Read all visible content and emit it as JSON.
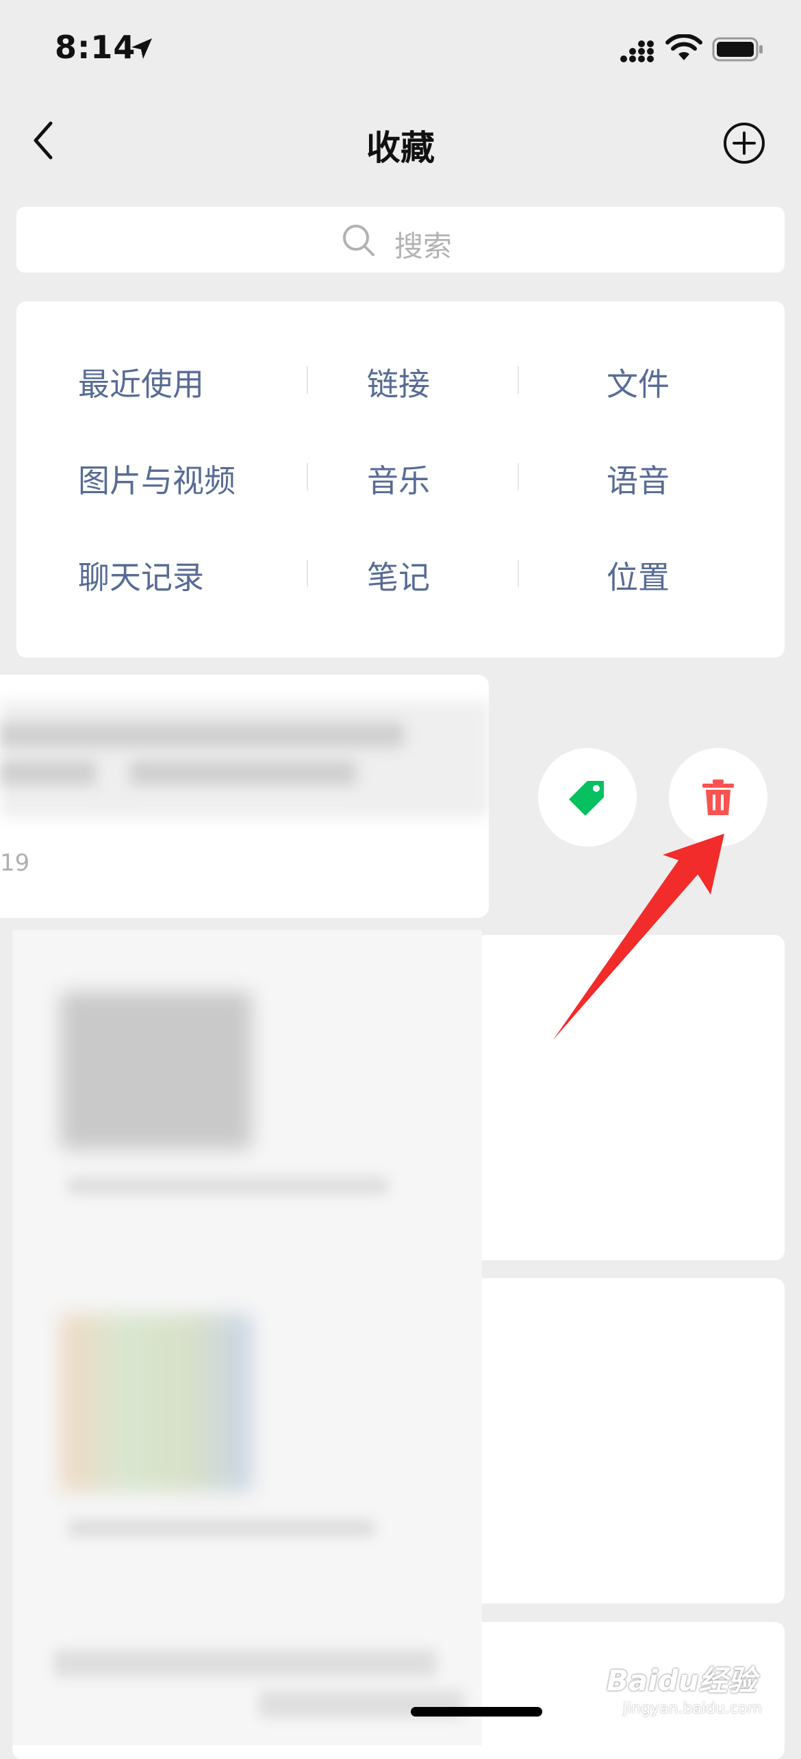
{
  "status_bar": {
    "time": "8:14"
  },
  "nav": {
    "title": "收藏"
  },
  "search": {
    "placeholder": "搜索"
  },
  "categories": [
    [
      "最近使用",
      "链接",
      "文件"
    ],
    [
      "图片与视频",
      "音乐",
      "语音"
    ],
    [
      "聊天记录",
      "笔记",
      "位置"
    ]
  ],
  "swiped_item": {
    "date_fragment": "19"
  },
  "actions": {
    "tag_icon": "tag-icon",
    "delete_icon": "trash-icon"
  },
  "colors": {
    "link_blue": "#576b95",
    "tag_green": "#07c160",
    "delete_red": "#fa5151",
    "arrow_red": "#f22b2b"
  },
  "watermark": {
    "brand": "Baidu经验",
    "url": "jingyan.baidu.com"
  }
}
